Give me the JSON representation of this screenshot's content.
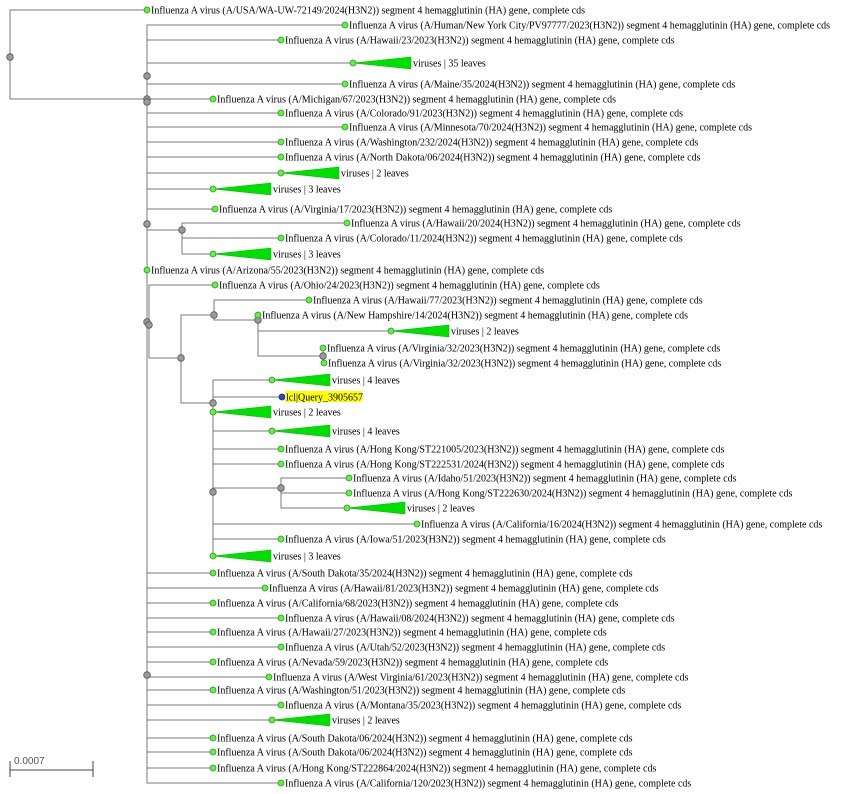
{
  "colors": {
    "leaf_node": "#66ee44",
    "internal_node": "#9a9a9a",
    "collapsed_clade": "#00e000",
    "query_highlight": "#ffff00",
    "query_node": "#3344cc",
    "branch": "#7a7a7a"
  },
  "scale_bar": {
    "label": "0.0007"
  },
  "tree": {
    "label": "",
    "children": [
      {
        "label": "Influenza A virus (A/USA/WA-UW-72149/2024(H3N2)) segment 4 hemagglutinin (HA) gene, complete cds"
      },
      {
        "label": "",
        "children": [
          {
            "label": "Influenza A virus (A/Human/New York City/PV97777/2023(H3N2)) segment 4 hemagglutinin (HA) gene, complete cds"
          },
          {
            "label": "Influenza A virus (A/Hawaii/23/2023(H3N2)) segment 4 hemagglutinin (HA) gene, complete cds"
          },
          {
            "label": "",
            "children": [
              {
                "label": "viruses | 35 leaves",
                "collapsed": true
              },
              {
                "label": "Influenza A virus (A/Maine/35/2024(H3N2)) segment 4 hemagglutinin (HA) gene, complete cds"
              }
            ]
          },
          {
            "label": "",
            "children": [
              {
                "label": "Influenza A virus (A/Michigan/67/2023(H3N2)) segment 4 hemagglutinin (HA) gene, complete cds"
              },
              {
                "label": "Influenza A virus (A/Colorado/91/2023(H3N2)) segment 4 hemagglutinin (HA) gene, complete cds"
              },
              {
                "label": "Influenza A virus (A/Minnesota/70/2024(H3N2)) segment 4 hemagglutinin (HA) gene, complete cds"
              },
              {
                "label": "Influenza A virus (A/Washington/232/2024(H3N2)) segment 4 hemagglutinin (HA) gene, complete cds"
              },
              {
                "label": "Influenza A virus (A/North Dakota/06/2024(H3N2)) segment 4 hemagglutinin (HA) gene, complete cds"
              },
              {
                "label": "viruses | 2 leaves",
                "collapsed": true
              }
            ]
          },
          {
            "label": "viruses | 3 leaves",
            "collapsed": true
          },
          {
            "label": "",
            "children": [
              {
                "label": "Influenza A virus (A/Virginia/17/2023(H3N2)) segment 4 hemagglutinin (HA) gene, complete cds"
              },
              {
                "label": "",
                "children": [
                  {
                    "label": "Influenza A virus (A/Hawaii/20/2024(H3N2)) segment 4 hemagglutinin (HA) gene, complete cds"
                  },
                  {
                    "label": "Influenza A virus (A/Colorado/11/2024(H3N2)) segment 4 hemagglutinin (HA) gene, complete cds"
                  },
                  {
                    "label": "viruses | 3 leaves",
                    "collapsed": true
                  }
                ]
              }
            ]
          },
          {
            "label": "",
            "children": [
              {
                "label": "Influenza A virus (A/Arizona/55/2023(H3N2)) segment 4 hemagglutinin (HA) gene, complete cds"
              },
              {
                "label": "",
                "children": [
                  {
                    "label": "Influenza A virus (A/Ohio/24/2023(H3N2)) segment 4 hemagglutinin (HA) gene, complete cds"
                  },
                  {
                    "label": "",
                    "children": [
                      {
                        "label": "",
                        "children": [
                          {
                            "label": "Influenza A virus (A/Hawaii/77/2023(H3N2)) segment 4 hemagglutinin (HA) gene, complete cds"
                          },
                          {
                            "label": "",
                            "children": [
                              {
                                "label": "Influenza A virus (A/New Hampshire/14/2024(H3N2)) segment 4 hemagglutinin (HA) gene, complete cds"
                              },
                              {
                                "label": "viruses | 2 leaves",
                                "collapsed": true
                              },
                              {
                                "label": "",
                                "children": [
                                  {
                                    "label": "Influenza A virus (A/Virginia/32/2023(H3N2)) segment 4 hemagglutinin (HA) gene, complete cds"
                                  },
                                  {
                                    "label": "Influenza A virus (A/Virginia/32/2023(H3N2)) segment 4 hemagglutinin (HA) gene, complete cds"
                                  }
                                ]
                              }
                            ]
                          }
                        ]
                      },
                      {
                        "label": "",
                        "children": [
                          {
                            "label": "viruses | 4 leaves",
                            "collapsed": true
                          },
                          {
                            "label": "lcl|Query_3905657",
                            "query": true
                          },
                          {
                            "label": "viruses | 2 leaves",
                            "collapsed": true
                          },
                          {
                            "label": "",
                            "children": [
                              {
                                "label": "viruses | 4 leaves",
                                "collapsed": true
                              },
                              {
                                "label": "Influenza A virus (A/Hong Kong/ST221005/2023(H3N2)) segment 4 hemagglutinin (HA) gene, complete cds"
                              },
                              {
                                "label": "Influenza A virus (A/Hong Kong/ST222531/2024(H3N2)) segment 4 hemagglutinin (HA) gene, complete cds"
                              },
                              {
                                "label": "",
                                "children": [
                                  {
                                    "label": "Influenza A virus (A/Idaho/51/2023(H3N2)) segment 4 hemagglutinin (HA) gene, complete cds"
                                  },
                                  {
                                    "label": "Influenza A virus (A/Hong Kong/ST222630/2024(H3N2)) segment 4 hemagglutinin (HA) gene, complete cds"
                                  },
                                  {
                                    "label": "viruses | 2 leaves",
                                    "collapsed": true
                                  }
                                ]
                              },
                              {
                                "label": "Influenza A virus (A/California/16/2024(H3N2)) segment 4 hemagglutinin (HA) gene, complete cds"
                              },
                              {
                                "label": "Influenza A virus (A/Iowa/51/2023(H3N2)) segment 4 hemagglutinin (HA) gene, complete cds"
                              },
                              {
                                "label": "viruses | 3 leaves",
                                "collapsed": true
                              }
                            ]
                          }
                        ]
                      }
                    ]
                  }
                ]
              }
            ]
          },
          {
            "label": "",
            "children": [
              {
                "label": "Influenza A virus (A/South Dakota/35/2024(H3N2)) segment 4 hemagglutinin (HA) gene, complete cds"
              },
              {
                "label": "Influenza A virus (A/Hawaii/81/2023(H3N2)) segment 4 hemagglutinin (HA) gene, complete cds"
              },
              {
                "label": "Influenza A virus (A/California/68/2023(H3N2)) segment 4 hemagglutinin (HA) gene, complete cds"
              },
              {
                "label": "Influenza A virus (A/Hawaii/08/2024(H3N2)) segment 4 hemagglutinin (HA) gene, complete cds"
              },
              {
                "label": "Influenza A virus (A/Hawaii/27/2023(H3N2)) segment 4 hemagglutinin (HA) gene, complete cds"
              },
              {
                "label": "Influenza A virus (A/Utah/52/2023(H3N2)) segment 4 hemagglutinin (HA) gene, complete cds"
              },
              {
                "label": "Influenza A virus (A/Nevada/59/2023(H3N2)) segment 4 hemagglutinin (HA) gene, complete cds"
              },
              {
                "label": "Influenza A virus (A/West Virginia/61/2023(H3N2)) segment 4 hemagglutinin (HA) gene, complete cds"
              },
              {
                "label": "Influenza A virus (A/Washington/51/2023(H3N2)) segment 4 hemagglutinin (HA) gene, complete cds"
              },
              {
                "label": "Influenza A virus (A/Montana/35/2023(H3N2)) segment 4 hemagglutinin (HA) gene, complete cds"
              },
              {
                "label": "viruses | 2 leaves",
                "collapsed": true
              },
              {
                "label": "Influenza A virus (A/South Dakota/06/2024(H3N2)) segment 4 hemagglutinin (HA) gene, complete cds"
              },
              {
                "label": "Influenza A virus (A/South Dakota/06/2024(H3N2)) segment 4 hemagglutinin (HA) gene, complete cds"
              },
              {
                "label": "Influenza A virus (A/Hong Kong/ST222864/2024(H3N2)) segment 4 hemagglutinin (HA) gene, complete cds"
              },
              {
                "label": "Influenza A virus (A/California/120/2023(H3N2)) segment 4 hemagglutinin (HA) gene, complete cds"
              }
            ]
          }
        ]
      }
    ]
  }
}
